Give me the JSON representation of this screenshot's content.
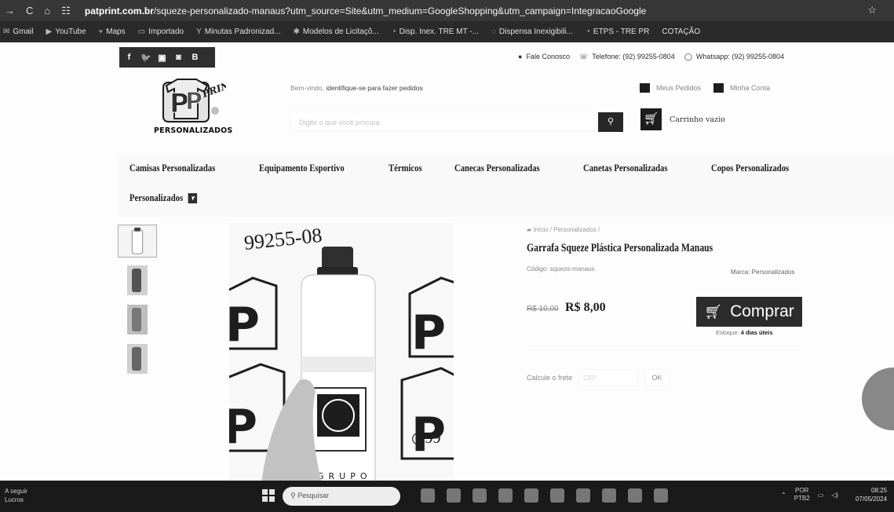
{
  "browser": {
    "nav_icons": [
      "back-icon",
      "reload-icon",
      "home-icon",
      "site-settings-icon"
    ],
    "url_domain": "patprint.com.br",
    "url_path": "/squeze-personalizado-manaus?utm_source=Site&utm_medium=GoogleShopping&utm_campaign=IntegracaoGoogle",
    "bookmarks": [
      "Gmail",
      "YouTube",
      "Maps",
      "Importado",
      "Minutas Padronizad...",
      "Modelos de Licitaçõ...",
      "Disp. Inex. TRE MT -...",
      "Dispensa Inexigibili...",
      "ETPS - TRE PR",
      "COTAÇÃO"
    ]
  },
  "topbar": {
    "social": [
      "f",
      "t",
      "yt",
      "ig",
      "B"
    ],
    "contact_label": "Fale Conosco",
    "phone": "Telefone: (92) 99255-0804",
    "whatsapp": "Whatsapp: (92) 99255-0804"
  },
  "header": {
    "logo_text": "PERSONALIZADOS",
    "welcome_prefix": "Bem-vindo,",
    "welcome_link": "identifique-se para fazer pedidos",
    "search_placeholder": "Digite o que você procura",
    "orders_label": "Meus Pedidos",
    "account_label": "Minha Conta",
    "cart_label": "Carrinho vazio"
  },
  "categories": [
    "Camisas Personalizadas",
    "Equipamento Esportivo",
    "Térmicos",
    "Canecas Personalizadas",
    "Canetas Personalizadas",
    "Copos Personalizados",
    "Personalizados"
  ],
  "product": {
    "breadcrumb": "Início / Personalizados /",
    "title": "Garrafa Squeze Plástica Personalizada Manaus",
    "code": "Código: squeze-manaus",
    "brand": "Marca: Personalizados",
    "old_price": "R$ 10,00",
    "price": "R$ 8,00",
    "buy_label": "Comprar",
    "stock_prefix": "Estoque:",
    "stock_value": "4 dias úteis",
    "shipping_label": "Calcule o frete",
    "cep_placeholder": "CEP",
    "ok_label": "OK",
    "image_phone_text": "99255-08",
    "bottle_print": "GRUPO"
  },
  "taskbar": {
    "news_line1": "A seguir",
    "news_line2": "Lucros",
    "search_placeholder": "Pesquisar",
    "lang_line1": "POR",
    "lang_line2": "PTB2",
    "time": "08:25",
    "date": "07/05/2024"
  }
}
